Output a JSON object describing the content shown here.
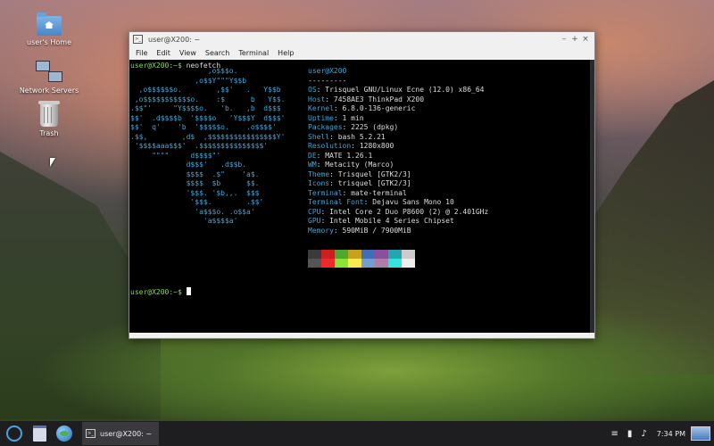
{
  "desktop": {
    "icons": [
      {
        "label": "user's Home"
      },
      {
        "label": "Network Servers"
      },
      {
        "label": "Trash"
      }
    ]
  },
  "window": {
    "title": "user@X200: ~",
    "controls": {
      "minimize": "–",
      "maximize": "+",
      "close": "×"
    },
    "menu": [
      "File",
      "Edit",
      "View",
      "Search",
      "Terminal",
      "Help"
    ]
  },
  "terminal": {
    "prompt": "user@X200:~$",
    "command": "neofetch",
    "ascii_art": [
      "                  ,o$$$o.",
      "               ,o$$Y\"\"\"Y$$b",
      "  ,o$$$$$$o.        ,$$'   .   Y$$b",
      " ,o$$$$$$$$$$$o.    :$      b   Y$$.",
      ".$$\"'     \"Y$$$$o.   'b.   ,b  d$$$",
      "$$'  .d$$$$b  '$$$$o   'Y$$$Y  d$$$'",
      "$$'  q'    'b  '$$$$$o.    .o$$$$'",
      ".$$,        ,d$  ,$$$$$$$$$$$$$$$$Y'",
      " '$$$$aaa$$$'  .$$$$$$$$$$$$$$$'",
      "     \"\"\"\"     d$$$$\"'",
      "             d$$$'   .d$$b.",
      "             $$$$  .$\"    'a$.",
      "             $$$$  $b      $$.",
      "             '$$$. '$b,,.  $$$",
      "              '$$$.        .$$'",
      "               'a$$$o. .o$$a'",
      "                 'a$$$$a'"
    ],
    "info_user": "user@X200",
    "info_sep": "---------",
    "info": [
      {
        "key": "OS",
        "value": "Trisquel GNU/Linux Ecne (12.0) x86_64"
      },
      {
        "key": "Host",
        "value": "7458AE3 ThinkPad X200"
      },
      {
        "key": "Kernel",
        "value": "6.8.0-136-generic"
      },
      {
        "key": "Uptime",
        "value": "1 min"
      },
      {
        "key": "Packages",
        "value": "2225 (dpkg)"
      },
      {
        "key": "Shell",
        "value": "bash 5.2.21"
      },
      {
        "key": "Resolution",
        "value": "1280x800"
      },
      {
        "key": "DE",
        "value": "MATE 1.26.1"
      },
      {
        "key": "WM",
        "value": "Metacity (Marco)"
      },
      {
        "key": "Theme",
        "value": "Trisquel [GTK2/3]"
      },
      {
        "key": "Icons",
        "value": "trisquel [GTK2/3]"
      },
      {
        "key": "Terminal",
        "value": "mate-terminal"
      },
      {
        "key": "Terminal Font",
        "value": "Dejavu Sans Mono 10"
      },
      {
        "key": "CPU",
        "value": "Intel Core 2 Duo P8600 (2) @ 2.401GHz"
      },
      {
        "key": "GPU",
        "value": "Intel Mobile 4 Series Chipset"
      },
      {
        "key": "Memory",
        "value": "590MiB / 7900MiB"
      }
    ],
    "palette": [
      "#3a3a3a",
      "#cc1f1f",
      "#4ea72e",
      "#c9a21c",
      "#3f6eb5",
      "#8a4f9e",
      "#23a6b0",
      "#cccccc",
      "#555555",
      "#ef2929",
      "#8ae234",
      "#fce94f",
      "#729fcf",
      "#ad7fa8",
      "#34e2e2",
      "#eeeeec"
    ]
  },
  "taskbar": {
    "task_label": "user@X200: ~",
    "clock": "7:34 PM"
  }
}
